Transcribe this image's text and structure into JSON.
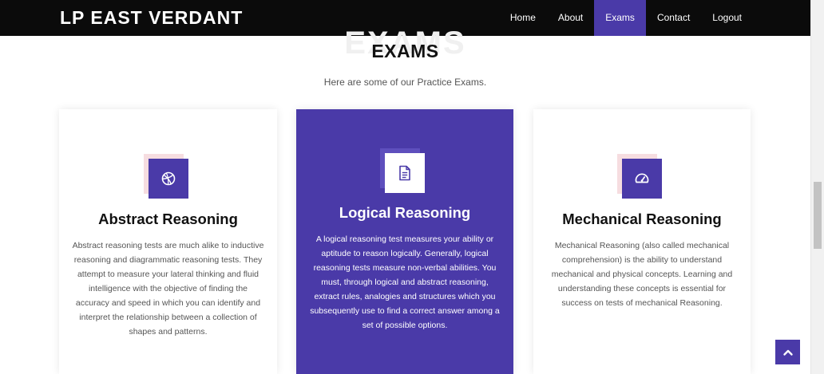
{
  "brand": {
    "name": "LP EAST VERDANT"
  },
  "nav": {
    "items": [
      {
        "label": "Home"
      },
      {
        "label": "About"
      },
      {
        "label": "Exams",
        "active": true
      },
      {
        "label": "Contact"
      },
      {
        "label": "Logout"
      }
    ]
  },
  "section": {
    "watermark": "EXAMS",
    "title": "EXAMS",
    "subtitle": "Here are some of our Practice Exams."
  },
  "cards": [
    {
      "icon": "dribbble-ball-icon",
      "title": "Abstract Reasoning",
      "text": "Abstract reasoning tests are much alike to inductive reasoning and diagrammatic reasoning tests. They attempt to measure your lateral thinking and fluid intelligence with the objective of finding the accuracy and speed in which you can identify and interpret the relationship between a collection of shapes and patterns."
    },
    {
      "icon": "document-icon",
      "title": "Logical Reasoning",
      "featured": true,
      "text": "A logical reasoning test measures your ability or aptitude to reason logically. Generally, logical reasoning tests measure non-verbal abilities. You must, through logical and abstract reasoning, extract rules, analogies and structures which you subsequently use to find a correct answer among a set of possible options."
    },
    {
      "icon": "speedometer-icon",
      "title": "Mechanical Reasoning",
      "text": "Mechanical Reasoning (also called mechanical comprehension) is the ability to understand mechanical and physical concepts. Learning and understanding these concepts is essential for success on tests of mechanical Reasoning."
    }
  ],
  "colors": {
    "accent": "#4a3aa8",
    "navbar": "#0b0b0b",
    "icon_deco": "#f6dde0"
  },
  "back_to_top": {
    "icon": "chevron-up-icon"
  }
}
